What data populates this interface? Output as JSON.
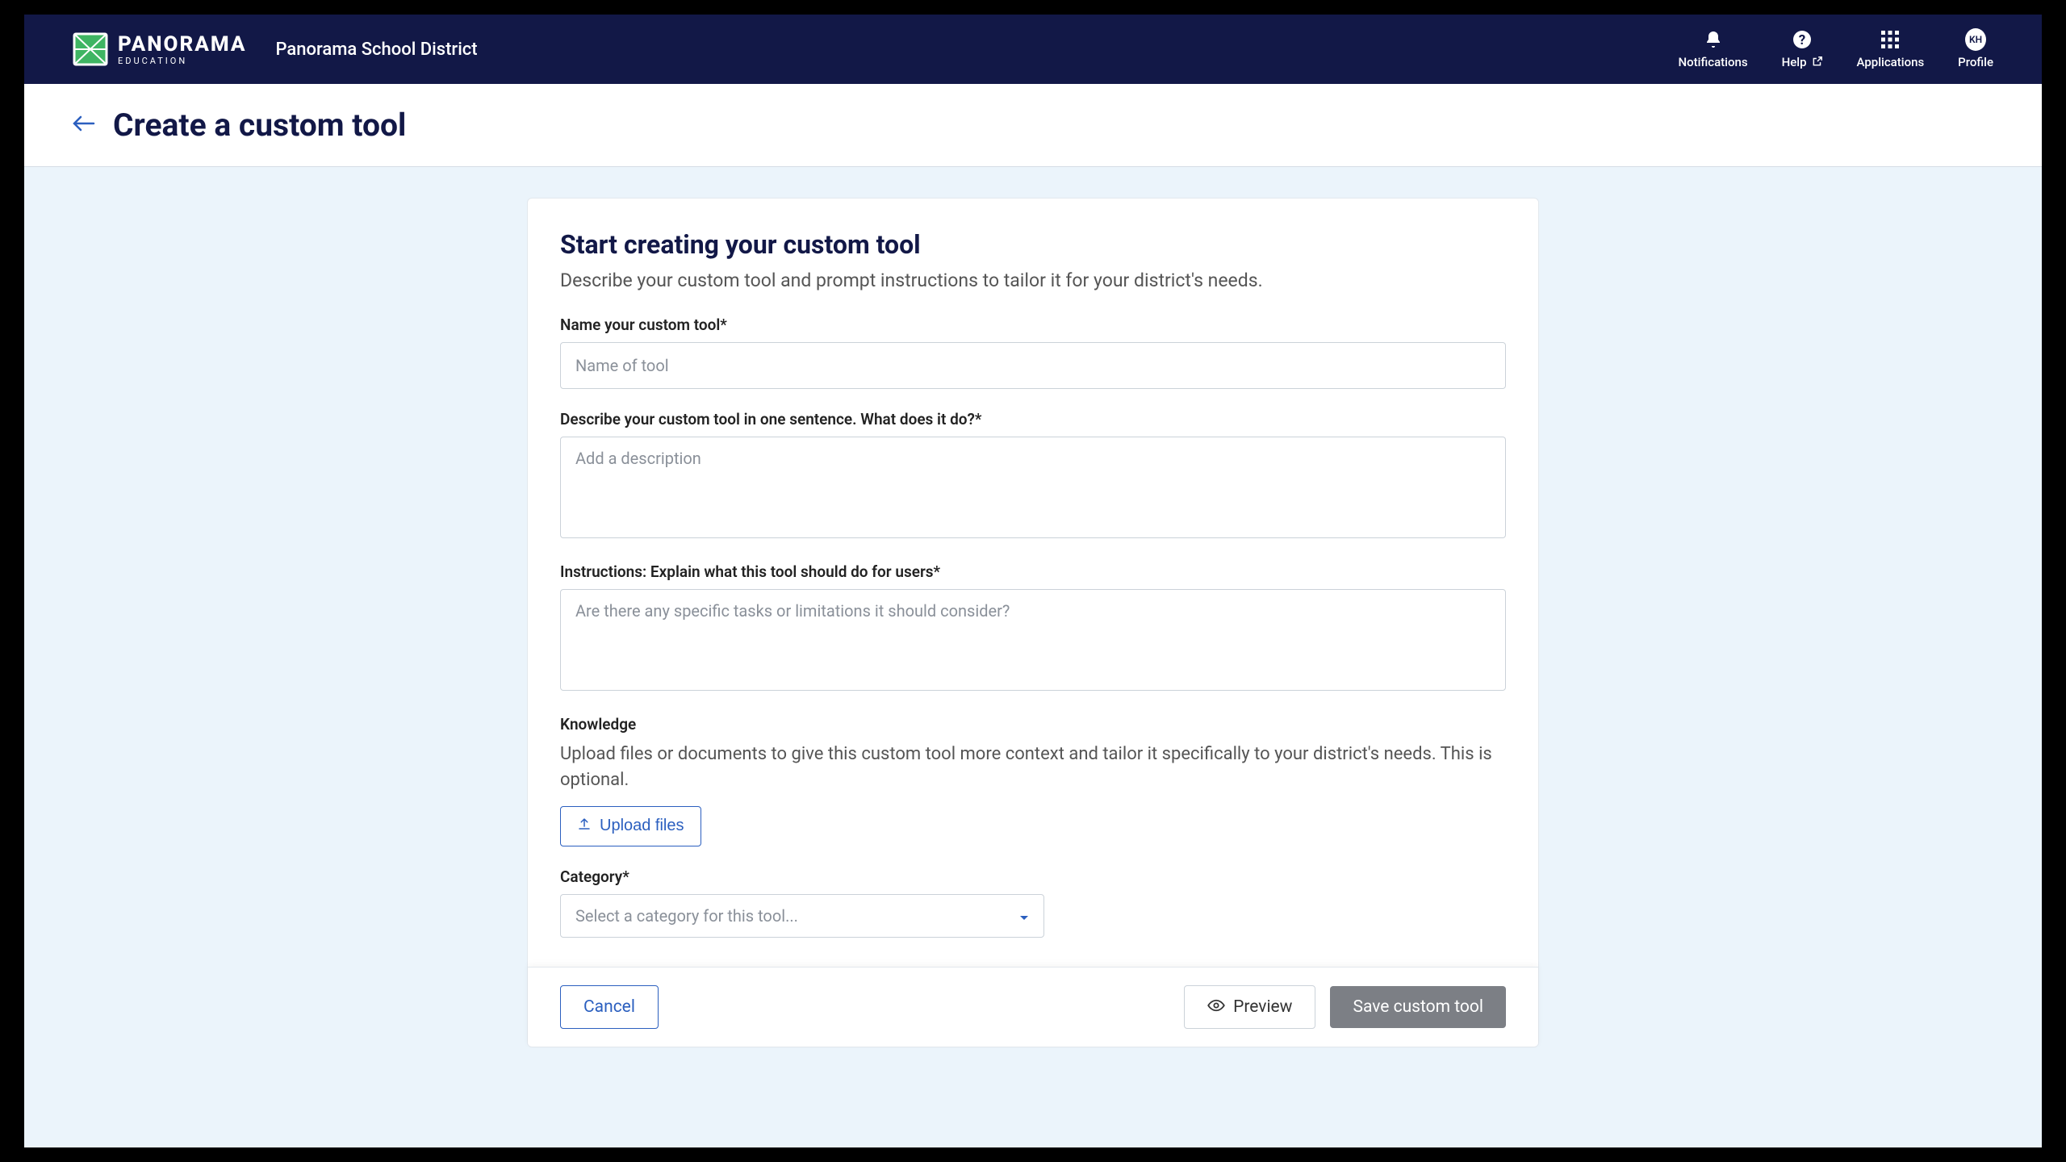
{
  "header": {
    "brand_main": "PANORAMA",
    "brand_sub": "EDUCATION",
    "district": "Panorama School District",
    "nav": {
      "notifications": "Notifications",
      "help": "Help",
      "applications": "Applications",
      "profile": "Profile",
      "avatar_initials": "KH"
    }
  },
  "page": {
    "title": "Create a custom tool"
  },
  "form": {
    "heading": "Start creating your custom tool",
    "subheading": "Describe your custom tool and prompt instructions to tailor it for your district's needs.",
    "name_label": "Name your custom tool*",
    "name_placeholder": "Name of tool",
    "desc_label": "Describe your custom tool in one sentence. What does it do?*",
    "desc_placeholder": "Add a description",
    "instr_label": "Instructions: Explain what this tool should do for users*",
    "instr_placeholder": "Are there any specific tasks or limitations it should consider?",
    "knowledge_label": "Knowledge",
    "knowledge_desc": "Upload files or documents to give this custom tool more context and tailor it specifically to your district's needs. This is optional.",
    "upload_label": "Upload files",
    "category_label": "Category*",
    "category_placeholder": "Select a category for this tool..."
  },
  "footer": {
    "cancel": "Cancel",
    "preview": "Preview",
    "save": "Save custom tool"
  }
}
